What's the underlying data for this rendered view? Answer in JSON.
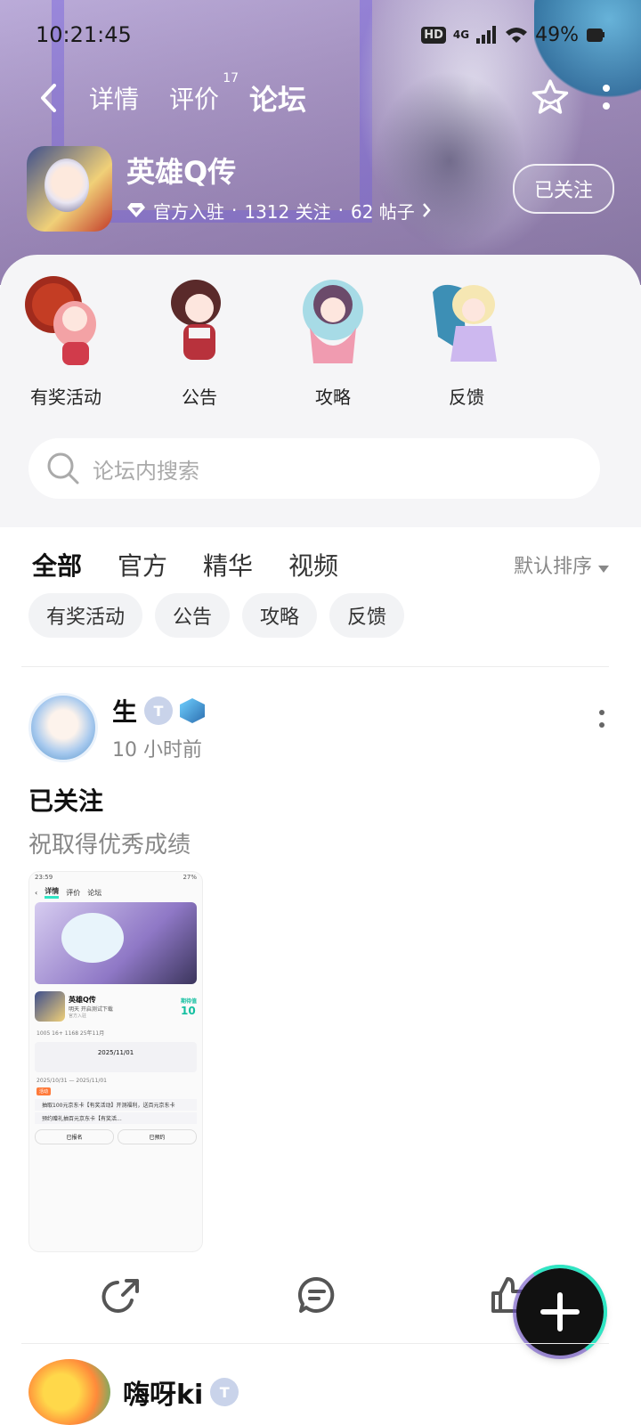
{
  "status_bar": {
    "time": "10:21:45",
    "hd": "HD",
    "network": "4G",
    "battery": "49%"
  },
  "nav": {
    "tabs": [
      {
        "label": "详情"
      },
      {
        "label": "评价",
        "badge": "17"
      },
      {
        "label": "论坛"
      }
    ]
  },
  "game": {
    "name": "英雄Q传",
    "official": "官方入驻",
    "follows": "1312 关注",
    "posts": "62 帖子",
    "follow_btn": "已关注",
    "sep": "·"
  },
  "categories": [
    {
      "label": "有奖活动"
    },
    {
      "label": "公告"
    },
    {
      "label": "攻略"
    },
    {
      "label": "反馈"
    }
  ],
  "search": {
    "placeholder": "论坛内搜索"
  },
  "filter_tabs": [
    {
      "label": "全部"
    },
    {
      "label": "官方"
    },
    {
      "label": "精华"
    },
    {
      "label": "视频"
    }
  ],
  "sort": {
    "label": "默认排序"
  },
  "chips": [
    {
      "label": "有奖活动"
    },
    {
      "label": "公告"
    },
    {
      "label": "攻略"
    },
    {
      "label": "反馈"
    }
  ],
  "post1": {
    "author": "生",
    "level": "T",
    "time": "10 小时前",
    "title": "已关注",
    "body": "祝取得优秀成绩",
    "screenshot": {
      "time": "23:59",
      "battery": "27%",
      "tabs": [
        "详情",
        "评价",
        "论坛"
      ],
      "game": "英雄Q传",
      "sub": "明天 开启测试下载",
      "official": "官方入驻",
      "score_label": "期待值",
      "score": "10",
      "stats": "1005   16+   1168   25年11月",
      "date": "2025/11/01",
      "test_period": "2025/10/31 — 2025/11/01",
      "tag": "活动",
      "line1": "抽取100元京东卡【有奖活动】开测福利，送百元京东卡",
      "line2": "预约赠礼抽百元京东卡【有奖活...",
      "btn1": "已报名",
      "btn2": "已预约"
    }
  },
  "post2": {
    "author": "嗨呀ki",
    "level": "T"
  },
  "colors": {
    "accent": "#30e6c5",
    "hero": "#a592c2",
    "panel": "#f5f5f7",
    "chip": "#f2f3f5"
  },
  "icons": [
    "back-arrow-icon",
    "star-icon",
    "more-icon",
    "diamond-icon",
    "chevron-right-icon",
    "search-icon",
    "caret-down-icon",
    "share-icon",
    "comment-icon",
    "like-icon",
    "plus-icon"
  ]
}
